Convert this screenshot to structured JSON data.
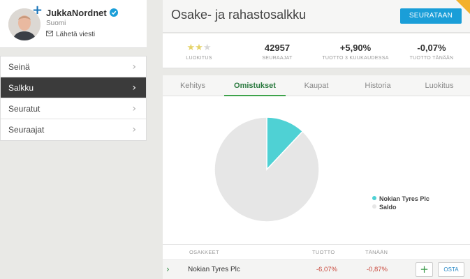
{
  "profile": {
    "username": "JukkaNordnet",
    "country": "Suomi",
    "send_message": "Lähetä viesti"
  },
  "sidemenu": {
    "items": [
      {
        "label": "Seinä",
        "active": false
      },
      {
        "label": "Salkku",
        "active": true
      },
      {
        "label": "Seuratut",
        "active": false
      },
      {
        "label": "Seuraajat",
        "active": false
      }
    ]
  },
  "header": {
    "title": "Osake- ja rahastosalkku",
    "follow_button": "SEURATAAN"
  },
  "stats": {
    "rating": {
      "stars_filled": 2,
      "stars_total": 5,
      "label": "LUOKITUS"
    },
    "followers": {
      "value": "42957",
      "label": "SEURAAJAT"
    },
    "return_3m": {
      "value": "+5,90%",
      "label": "TUOTTO 3 KUUKAUDESSA"
    },
    "return_today": {
      "value": "-0,07%",
      "label": "TUOTTO TÄNÄÄN"
    }
  },
  "tabs": [
    {
      "label": "Kehitys",
      "active": false
    },
    {
      "label": "Omistukset",
      "active": true
    },
    {
      "label": "Kaupat",
      "active": false
    },
    {
      "label": "Historia",
      "active": false
    },
    {
      "label": "Luokitus",
      "active": false
    }
  ],
  "chart_data": {
    "type": "pie",
    "slices": [
      {
        "label": "Nokian Tyres Plc",
        "value": 12,
        "color": "#4fd1d4"
      },
      {
        "label": "Saldo",
        "value": 88,
        "color": "#e6e6e6"
      }
    ]
  },
  "table": {
    "headers": {
      "holdings": "OSAKKEET",
      "return": "TUOTTO",
      "today": "TÄNÄÄN"
    },
    "rows": [
      {
        "name": "Nokian Tyres Plc",
        "return": "-6,07%",
        "today": "-0,87%",
        "buy_label": "OSTA"
      }
    ]
  },
  "colors": {
    "accent_blue": "#1a9ed8",
    "positive": "#1a8fc6",
    "negative": "#c9483c",
    "active_tab": "#3ea34b"
  }
}
